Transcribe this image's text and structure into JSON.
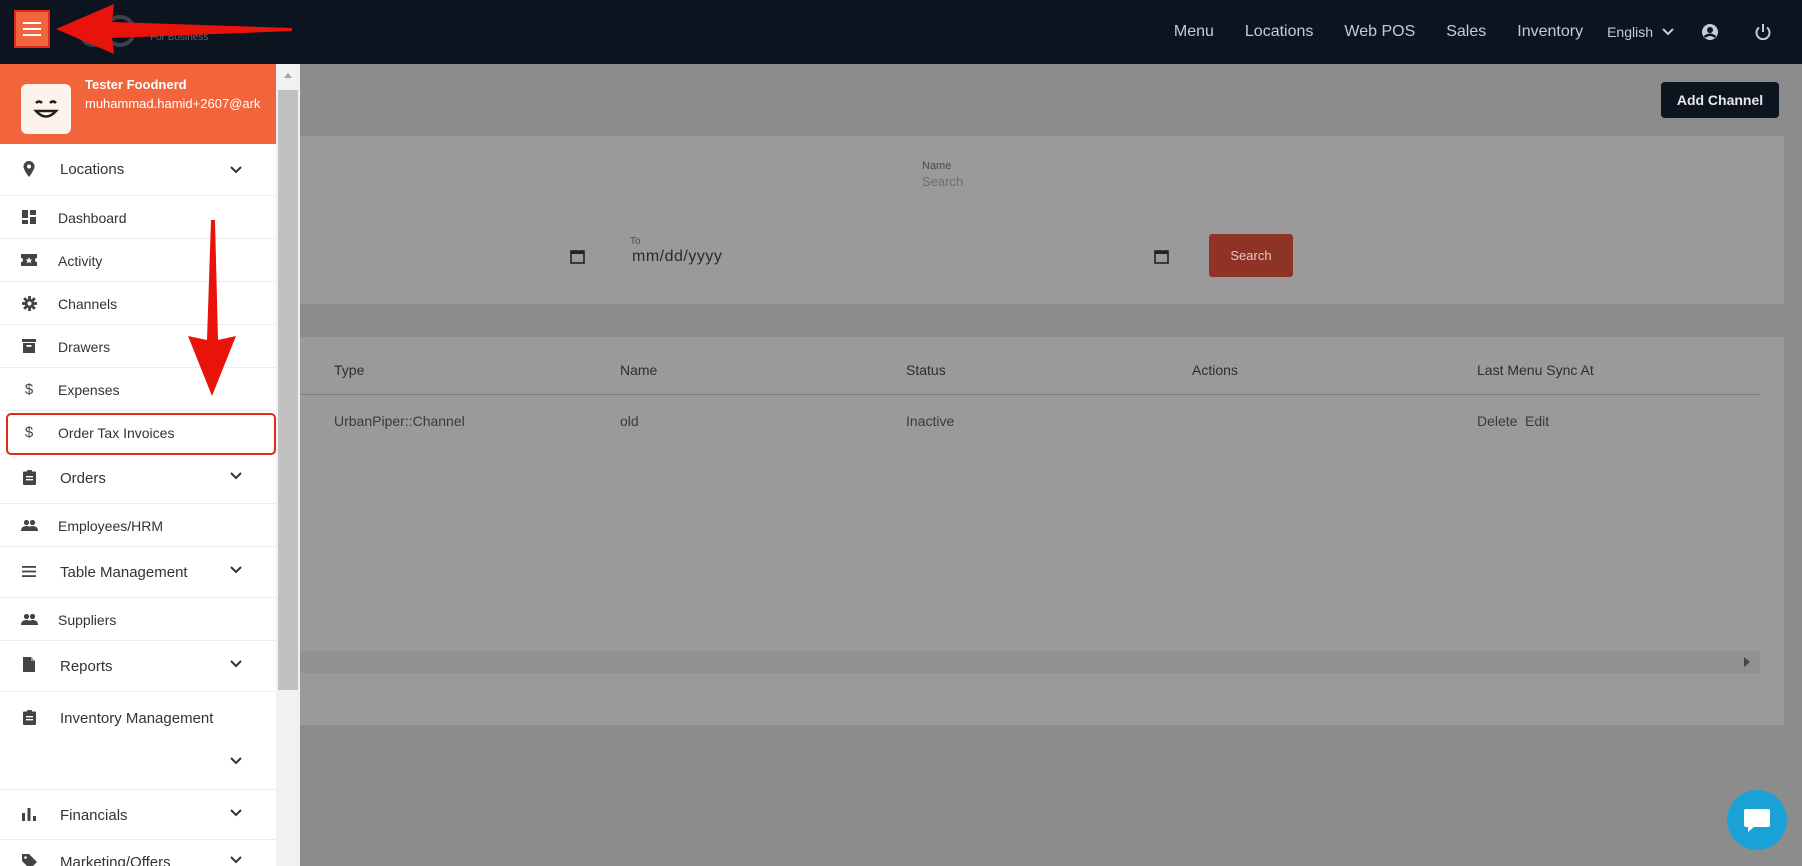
{
  "topbar": {
    "logo_sub": "For Business",
    "nav": [
      "Menu",
      "Locations",
      "Web POS",
      "Sales",
      "Inventory"
    ],
    "language": "English"
  },
  "profile": {
    "name": "Tester Foodnerd",
    "email": "muhammad.hamid+2607@ark"
  },
  "sidebar": {
    "items": [
      {
        "label": "Locations",
        "icon": "pin-icon",
        "group": true
      },
      {
        "label": "Dashboard",
        "icon": "dashboard-icon"
      },
      {
        "label": "Activity",
        "icon": "ticket-icon"
      },
      {
        "label": "Channels",
        "icon": "gear-icon"
      },
      {
        "label": "Drawers",
        "icon": "archive-icon"
      },
      {
        "label": "Expenses",
        "icon": "dollar-icon"
      },
      {
        "label": "Order Tax Invoices",
        "icon": "dollar-icon"
      },
      {
        "label": "Orders",
        "icon": "clipboard-icon",
        "group": true
      },
      {
        "label": "Employees/HRM",
        "icon": "people-icon"
      },
      {
        "label": "Table Management",
        "icon": "list-icon",
        "group": true
      },
      {
        "label": "Suppliers",
        "icon": "people-icon"
      },
      {
        "label": "Reports",
        "icon": "file-icon",
        "group": true
      },
      {
        "label": "Inventory Management",
        "icon": "clipboard-icon",
        "group": true
      },
      {
        "label": "Financials",
        "icon": "bar-chart-icon",
        "group": true
      },
      {
        "label": "Marketing/Offers",
        "icon": "tag-icon",
        "group": true
      }
    ]
  },
  "main": {
    "add_channel": "Add Channel",
    "filters": {
      "name_label": "Name",
      "name_placeholder": "Search",
      "to_label": "To",
      "date_placeholder": "mm/dd/yyyy",
      "search_button": "Search"
    },
    "table": {
      "columns": [
        "Type",
        "Name",
        "Status",
        "Actions",
        "Last Menu Sync At"
      ],
      "rows": [
        {
          "type": "UrbanPiper::Channel",
          "name": "old",
          "status": "Inactive",
          "actions": [
            "Delete",
            "Edit"
          ]
        }
      ]
    }
  },
  "colors": {
    "accent": "#f2643b",
    "topbar": "#0c1420",
    "annotation_red": "#e02a1a",
    "chat": "#1aa2d6"
  }
}
